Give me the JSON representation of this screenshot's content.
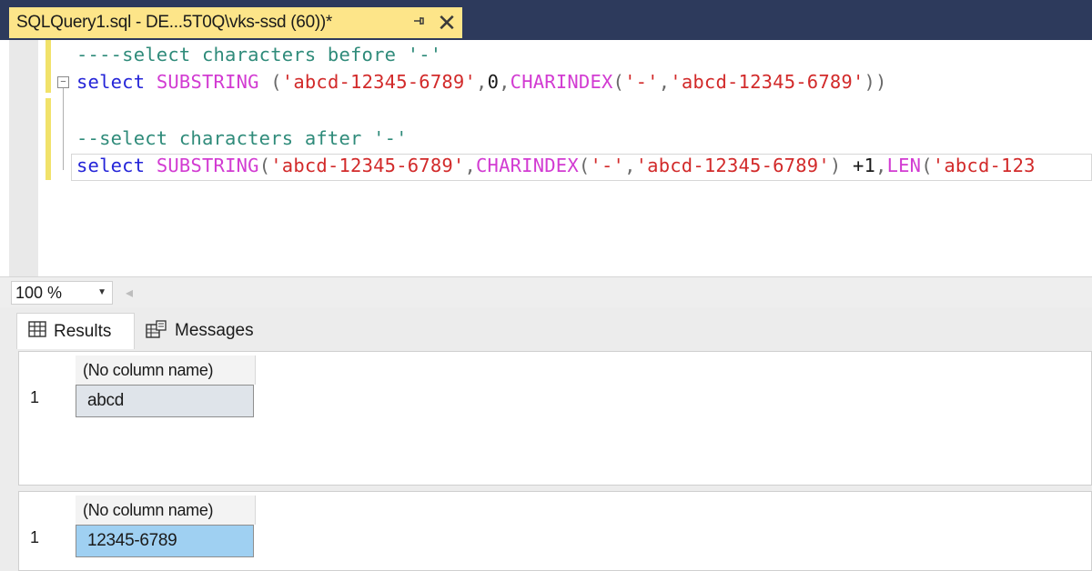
{
  "tab": {
    "title": "SQLQuery1.sql - DE...5T0Q\\vks-ssd (60))*",
    "pin_icon": "pin-icon",
    "close_icon": "close-icon"
  },
  "editor": {
    "line1": "----select characters before '-'",
    "line2": {
      "select": "select",
      "fn1": "SUBSTRING",
      "open": " (",
      "str1": "'abcd-12345-6789'",
      "c1": ",",
      "n0": "0",
      "c2": ",",
      "fn2": "CHARINDEX",
      "p1": "(",
      "str2": "'-'",
      "c3": ",",
      "str3": "'abcd-12345-6789'",
      "close": "))"
    },
    "line3": "--select characters after '-'",
    "line4": {
      "select": "select",
      "fn1": "SUBSTRING",
      "p1": "(",
      "str1": "'abcd-12345-6789'",
      "c1": ",",
      "fn2": "CHARINDEX",
      "p2": "(",
      "str2": "'-'",
      "c2": ",",
      "str3": "'abcd-12345-6789'",
      "p3": ")",
      "plus": " +1",
      "c3": ",",
      "fn3": "LEN",
      "p4": "(",
      "str4": "'abcd-123"
    }
  },
  "zoom": {
    "value": "100 %"
  },
  "results": {
    "tabs": [
      {
        "label": "Results",
        "icon": "grid-icon"
      },
      {
        "label": "Messages",
        "icon": "messages-icon"
      }
    ],
    "grids": [
      {
        "column": "(No column name)",
        "row": "1",
        "value": "abcd"
      },
      {
        "column": "(No column name)",
        "row": "1",
        "value": "12345-6789"
      }
    ]
  },
  "colors": {
    "tab_bar": "#2d3a5c",
    "active_tab": "#fde589",
    "keyword": "#2424d8",
    "function": "#d23bd2",
    "string": "#d22a2a",
    "comment": "#2f8b7a",
    "selected_cell": "#9fd0f2"
  }
}
